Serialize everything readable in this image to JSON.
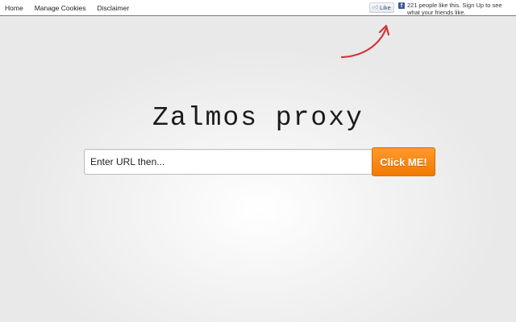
{
  "nav": {
    "items": [
      {
        "label": "Home"
      },
      {
        "label": "Manage Cookies"
      },
      {
        "label": "Disclaimer"
      }
    ]
  },
  "social": {
    "like_label": "Like",
    "like_text": "221 people like this. Sign Up to see what your friends like.",
    "brand_color": "#3b5998"
  },
  "arrow": {
    "color": "#d0343a"
  },
  "main": {
    "title": "Zalmos proxy",
    "url_placeholder": "Enter URL then...",
    "submit_label": "Click ME!",
    "accent_color": "#f58a14"
  }
}
